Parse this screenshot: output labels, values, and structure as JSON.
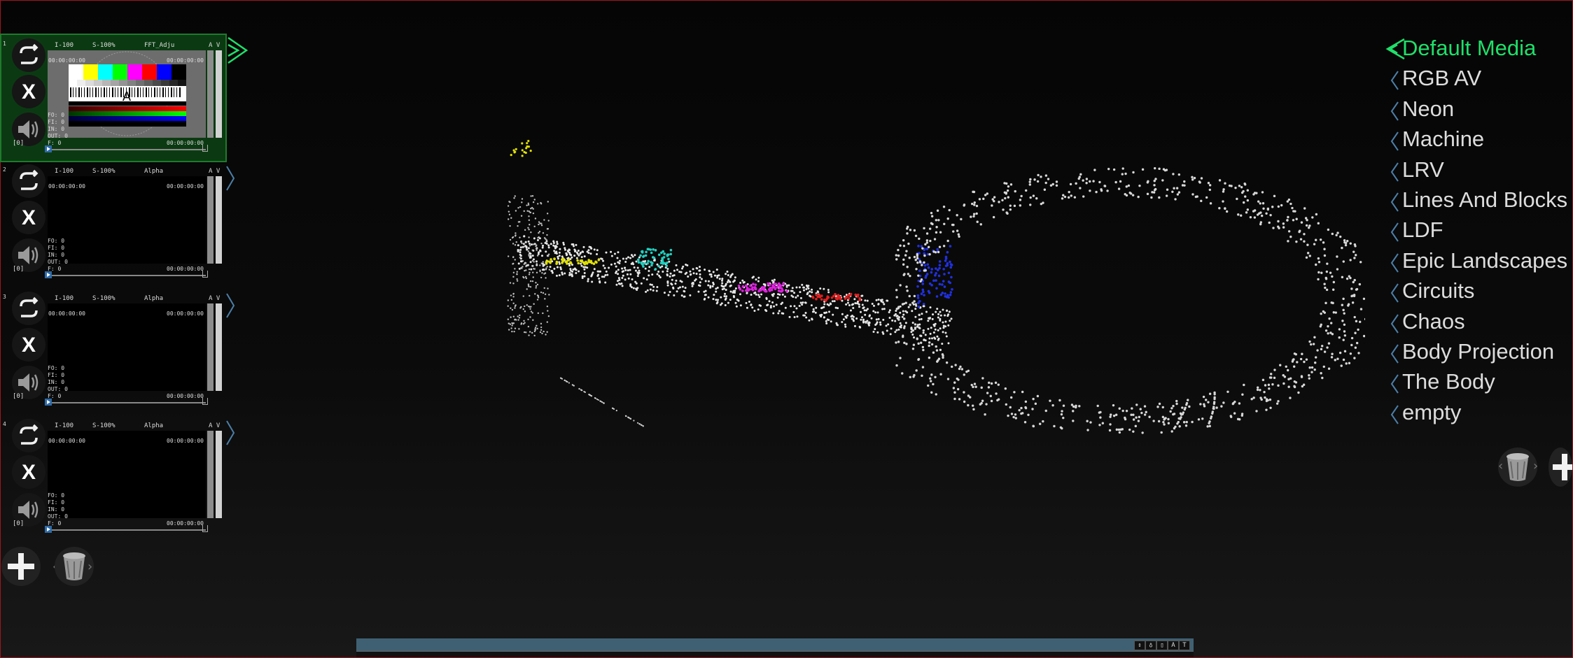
{
  "layers": [
    {
      "num": "1",
      "intensity": "I-100",
      "speed": "S-100%",
      "effect": "FFT_Adju",
      "av": "A V",
      "tc_start": "00:00:00:00",
      "tc_end": "00:00:00:00",
      "tc_end2": "00:00:00:00",
      "counters": "FO: 0\nFI: 0\nIN: 0\nOUT: 0\nF: 0",
      "index": "[0]",
      "close_label": "X"
    },
    {
      "num": "2",
      "intensity": "I-100",
      "speed": "S-100%",
      "effect": "Alpha",
      "av": "A V",
      "tc_start": "00:00:00:00",
      "tc_end": "00:00:00:00",
      "tc_end2": "00:00:00:00",
      "counters": "FO: 0\nFI: 0\nIN: 0\nOUT: 0\nF: 0",
      "index": "[0]",
      "close_label": "X"
    },
    {
      "num": "3",
      "intensity": "I-100",
      "speed": "S-100%",
      "effect": "Alpha",
      "av": "A V",
      "tc_start": "00:00:00:00",
      "tc_end": "00:00:00:00",
      "tc_end2": "00:00:00:00",
      "counters": "FO: 0\nFI: 0\nIN: 0\nOUT: 0\nF: 0",
      "index": "[0]",
      "close_label": "X"
    },
    {
      "num": "4",
      "intensity": "I-100",
      "speed": "S-100%",
      "effect": "Alpha",
      "av": "A V",
      "tc_start": "00:00:00:00",
      "tc_end": "00:00:00:00",
      "tc_end2": "00:00:00:00",
      "counters": "FO: 0\nFI: 0\nIN: 0\nOUT: 0\nF: 0",
      "index": "[0]",
      "close_label": "X"
    }
  ],
  "media_banks": [
    "Default Media",
    "RGB AV",
    "Neon",
    "Machine",
    "LRV",
    "Lines And Blocks",
    "LDF",
    "Epic Landscapes",
    "Circuits",
    "Chaos",
    "Body Projection",
    "The Body",
    "empty"
  ],
  "selected_media": "Default Media",
  "timeline_buttons": [
    "⇕",
    "♁",
    "▯",
    "A",
    "T"
  ],
  "thumbnail_label": "A",
  "colors": {
    "active_green": "#1fe06a",
    "layer_active_bg": "#0b3a12",
    "timeline_bar": "#3f6072",
    "frame_border": "#a4141c"
  },
  "icons": {
    "loop": "loop-icon",
    "close": "close-icon",
    "speaker": "speaker-icon",
    "add": "plus-icon",
    "trash": "trash-icon"
  }
}
